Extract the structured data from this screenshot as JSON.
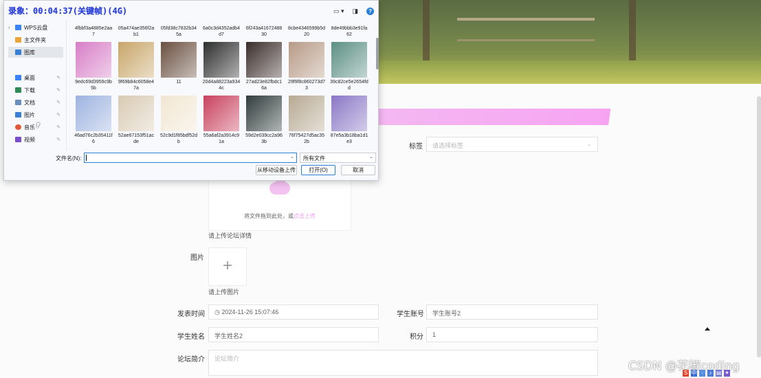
{
  "recording": {
    "label": "录象：00:04:37(关键帧)(4G)"
  },
  "dialog": {
    "nav_items": [
      {
        "label": "WPS云盘",
        "icon": "cloud-icon",
        "color": "#3b82f6",
        "expand": "›"
      },
      {
        "label": "主文件夹",
        "icon": "home-icon",
        "color": "#e7a53c",
        "expand": ""
      },
      {
        "label": "图库",
        "icon": "gallery-icon",
        "color": "#3b7fd4",
        "expand": ""
      },
      {
        "label": "桌面",
        "icon": "desktop-icon",
        "color": "#3b82f6",
        "expand": ""
      },
      {
        "label": "下载",
        "icon": "download-icon",
        "color": "#2e8b57",
        "expand": ""
      },
      {
        "label": "文档",
        "icon": "document-icon",
        "color": "#6c8ebf",
        "expand": ""
      },
      {
        "label": "图片",
        "icon": "pictures-icon",
        "color": "#3b7fd4",
        "expand": ""
      },
      {
        "label": "音乐",
        "icon": "music-icon",
        "color": "#e05a3a",
        "expand": ""
      },
      {
        "label": "视频",
        "icon": "video-icon",
        "color": "#7b4fc9",
        "expand": ""
      }
    ],
    "top_row_names": [
      "4fbbf3a4885e2aa7",
      "05a474ae356f2ab1",
      "05fd38c7832b345a",
      "6a0c3d4352adb4d7",
      "6f243a4167248830",
      "8cbe4346599b5d20",
      "8de49bbb3e91fa62"
    ],
    "files": [
      {
        "name": "9edc69d3959c9b5b",
        "color": "#d77ec6"
      },
      {
        "name": "9f69b84c6058e47a",
        "color": "#c8a66a"
      },
      {
        "name": "11",
        "color": "#6a5040"
      },
      {
        "name": "20d4a88223a9344c",
        "color": "#2e2e2e"
      },
      {
        "name": "27ad23e82fbdc16a",
        "color": "#3a2d2a"
      },
      {
        "name": "29f9f8c860273d73",
        "color": "#b79a86"
      },
      {
        "name": "39c82ce5e2654fdd",
        "color": "#5b8f84"
      },
      {
        "name": "46ad76c2b35411f6",
        "color": "#9db3e0"
      },
      {
        "name": "52ae67153f51acde",
        "color": "#d9cbb4"
      },
      {
        "name": "52c9d1f85bdf52db",
        "color": "#f1e6d2"
      },
      {
        "name": "55a6af2a3914c91a",
        "color": "#c8415e"
      },
      {
        "name": "59d2e039cc2a963b",
        "color": "#2f3b3a"
      },
      {
        "name": "76f75427d5ac352b",
        "color": "#b7aa93"
      },
      {
        "name": "87e5a3b18ba1d1e3",
        "color": "#8a77c6"
      }
    ],
    "filename_label": "文件名(N):",
    "filename_value": "",
    "filetype_value": "所有文件",
    "btn_mobile": "从移动设备上传",
    "btn_open": "打开(O)",
    "btn_cancel": "取消",
    "help_glyph": "?"
  },
  "form": {
    "tag_label": "标签",
    "tag_placeholder": "请选择标签",
    "upload_text": "将文件拖到此处，或",
    "upload_link": "点击上传",
    "detail_hint": "请上传论坛详情",
    "image_label": "图片",
    "image_plus": "+",
    "image_hint": "请上传图片",
    "publish_time_label": "发表时间",
    "publish_time_value": "2024-11-26 15:07:46",
    "student_account_label": "学生账号",
    "student_account_value": "学生账号2",
    "student_name_label": "学生姓名",
    "student_name_value": "学生姓名2",
    "points_label": "积分",
    "points_value": "1",
    "intro_label": "论坛简介",
    "intro_placeholder": "论坛简介"
  },
  "watermark": "CSDN @花椒coding",
  "colors": {
    "accent_pink": "#f3a0ef",
    "dialog_blue": "#2b7fd4"
  }
}
